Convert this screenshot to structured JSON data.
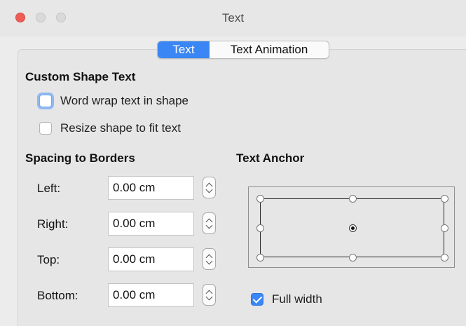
{
  "window": {
    "title": "Text"
  },
  "tabs": [
    {
      "label": "Text",
      "active": true
    },
    {
      "label": "Text Animation",
      "active": false
    }
  ],
  "custom_shape_text": {
    "heading": "Custom Shape Text",
    "word_wrap": {
      "label": "Word wrap text in shape",
      "checked": false,
      "focused": true
    },
    "resize_shape": {
      "label": "Resize shape to fit text",
      "checked": false
    }
  },
  "spacing": {
    "heading": "Spacing to Borders",
    "fields": [
      {
        "label": "Left:",
        "value": "0.00 cm"
      },
      {
        "label": "Right:",
        "value": "0.00 cm"
      },
      {
        "label": "Top:",
        "value": "0.00 cm"
      },
      {
        "label": "Bottom:",
        "value": "0.00 cm"
      }
    ]
  },
  "text_anchor": {
    "heading": "Text Anchor",
    "selected": "center",
    "full_width": {
      "label": "Full width",
      "checked": true
    }
  },
  "colors": {
    "accent": "#3a86f4",
    "close_button": "#ee5e57"
  }
}
